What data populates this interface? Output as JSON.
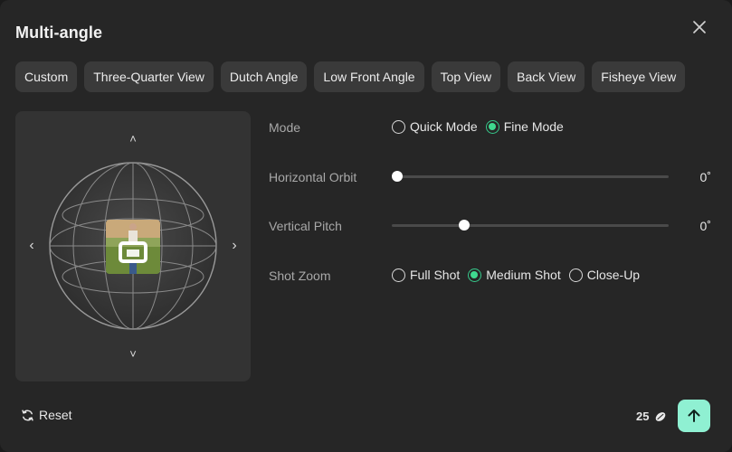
{
  "dialog": {
    "title": "Multi-angle"
  },
  "tabs": [
    {
      "label": "Custom",
      "active": true
    },
    {
      "label": "Three-Quarter View",
      "active": false
    },
    {
      "label": "Dutch Angle",
      "active": false
    },
    {
      "label": "Low Front Angle",
      "active": false
    },
    {
      "label": "Top View",
      "active": false
    },
    {
      "label": "Back View",
      "active": false
    },
    {
      "label": "Fisheye View",
      "active": false
    }
  ],
  "preview": {
    "arrows": {
      "up": "˄",
      "down": "˅",
      "left": "‹",
      "right": "›"
    }
  },
  "settings": {
    "mode": {
      "label": "Mode",
      "options": [
        {
          "label": "Quick Mode",
          "checked": false
        },
        {
          "label": "Fine Mode",
          "checked": true
        }
      ]
    },
    "horizontal_orbit": {
      "label": "Horizontal Orbit",
      "value_text": "0˚",
      "level": 0.02
    },
    "vertical_pitch": {
      "label": "Vertical Pitch",
      "value_text": "0˚",
      "level": 0.26
    },
    "shot_zoom": {
      "label": "Shot Zoom",
      "options": [
        {
          "label": "Full Shot",
          "checked": false
        },
        {
          "label": "Medium Shot",
          "checked": true
        },
        {
          "label": "Close-Up",
          "checked": false
        }
      ]
    }
  },
  "footer": {
    "reset_label": "Reset",
    "credits": "25",
    "accent_color": "#8ff0d2",
    "icons": {
      "reset": "refresh-icon",
      "credits": "bean-icon",
      "submit": "arrow-up-icon",
      "close": "close-icon"
    }
  }
}
